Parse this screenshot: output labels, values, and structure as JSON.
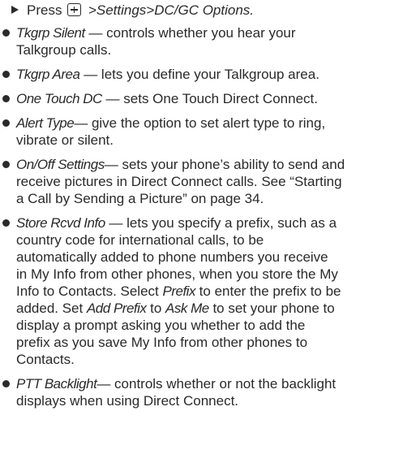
{
  "step": {
    "prefix": "Press",
    "key_icon": "menu-key-icon",
    "path": " >Settings>DC/GC Options."
  },
  "items": [
    {
      "term": "Tkgrp Silent",
      "lines": [
        " — controls whether you hear your",
        "Talkgroup calls."
      ]
    },
    {
      "term": "Tkgrp Area",
      "lines": [
        " — lets you define your Talkgroup area."
      ]
    },
    {
      "term": "One Touch DC",
      "lines": [
        " — sets One Touch Direct Connect."
      ]
    },
    {
      "term": "Alert Type",
      "lines": [
        "— give the option to set alert type to ring,",
        "vibrate or silent."
      ]
    },
    {
      "term": "On/Off Settings",
      "lines": [
        "— sets your phone’s ability to send and",
        "receive pictures in Direct Connect calls. See “Starting",
        "a Call by Sending a Picture” on page 34."
      ]
    },
    {
      "term": "Store Rcvd Info",
      "lines": [
        " — lets you specify a prefix, such as a",
        "country code for international calls, to be",
        "automatically added to phone numbers you receive",
        "in My Info from other phones, when you store the My",
        "Info to Contacts. Select ",
        "Prefix",
        " to enter the prefix to be",
        "added. Set ",
        "Add Prefix",
        " to ",
        "Ask Me",
        " to set your phone to",
        "display a prompt asking you whether to add the",
        "prefix as you save My Info from other phones to",
        "Contacts."
      ]
    },
    {
      "term": "PTT Backlight",
      "lines": [
        "— controls whether or not the backlight",
        "displays when using Direct Connect."
      ]
    }
  ]
}
